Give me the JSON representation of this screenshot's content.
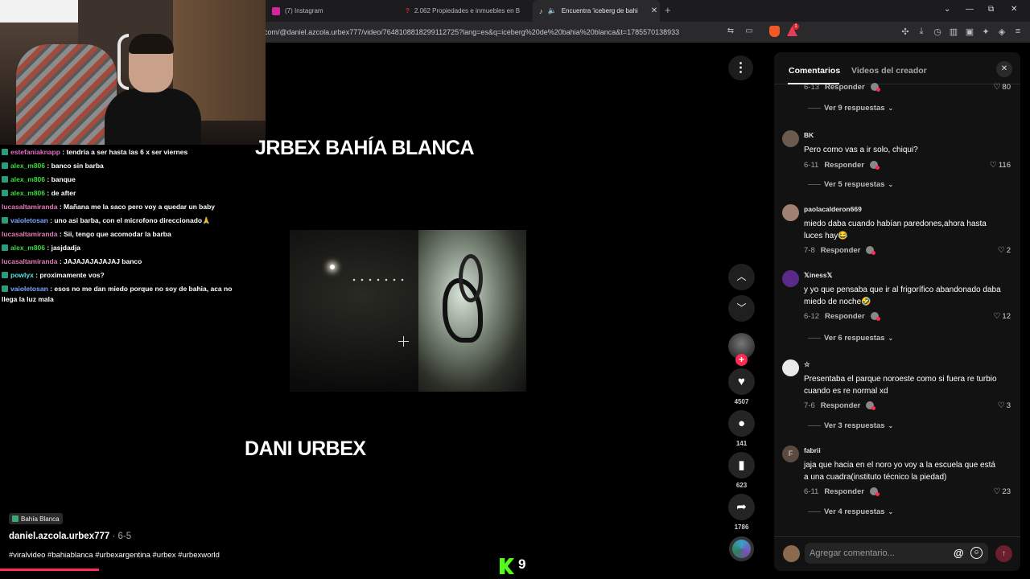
{
  "browser": {
    "tabs": [
      {
        "title": "(7) Instagram",
        "color": "#d6249f"
      },
      {
        "title": "2.062 Propiedades e inmuebles en B",
        "color": "#e0232a"
      },
      {
        "title": "Encuentra 'iceberg de bahia b",
        "color": "#ffffff"
      }
    ],
    "url": "com/@daniel.azcola.urbex777/video/7648108818299112725?lang=es&q=iceberg%20de%20bahia%20blanca&t=1785570138933",
    "notification_count": "1",
    "window_controls": {
      "collapse": "⌄",
      "minimize": "—",
      "restore": "⧉",
      "close": "✕"
    }
  },
  "chat": [
    {
      "user": "estefaniaknapp",
      "color": "#e26cc3",
      "message": ": tendria a ser hasta las 6 x ser viernes"
    },
    {
      "user": "alex_m806",
      "color": "#3cdc3c",
      "message": ": banco sin barba"
    },
    {
      "user": "alex_m806",
      "color": "#3cdc3c",
      "message": ": banque"
    },
    {
      "user": "alex_m806",
      "color": "#3cdc3c",
      "message": ": de after"
    },
    {
      "user": "lucasaltamiranda",
      "color": "#e27ab7",
      "message": ": Mañana me la saco pero voy a quedar un baby"
    },
    {
      "user": "vaioletosan",
      "color": "#7aa7ff",
      "message": ": uno asi barba, con el microfono direccionado🙏"
    },
    {
      "user": "lucasaltamiranda",
      "color": "#e27ab7",
      "message": ": Sii, tengo que acomodar la barba"
    },
    {
      "user": "alex_m806",
      "color": "#3cdc3c",
      "message": ": jasjdadja"
    },
    {
      "user": "lucasaltamiranda",
      "color": "#e27ab7",
      "message": ": JAJAJAJAJAJAJ banco"
    },
    {
      "user": "powlyx",
      "color": "#5fe0e0",
      "message": ": proximamente vos?"
    },
    {
      "user": "vaioletosan",
      "color": "#7aa7ff",
      "message": ": esos no me dan miedo porque no soy de bahia, aca no llega la luz mala"
    }
  ],
  "video": {
    "title_top": "JRBEX BAHÍA BLANCA",
    "title_bottom": "DANI URBEX",
    "location": "Bahía Blanca",
    "author": "daniel.azcola.urbex777",
    "date": " · 6-5",
    "hashtags": "#viralvideo #bahiablanca #urbexargentina #urbex #urbexworld",
    "more_icon": "⋮",
    "progress": 0.096,
    "kick_count": "9"
  },
  "actions": {
    "likes": "4507",
    "comments": "141",
    "saves": "623",
    "shares": "1786"
  },
  "panel": {
    "tab_comments": "Comentarios",
    "tab_creator_videos": "Videos del creador",
    "close": "✕",
    "reply_label": "Responder",
    "comments": [
      {
        "type": "partial",
        "meta": "6-13",
        "likes": "80",
        "replies": "Ver 9 respuestas"
      },
      {
        "avatar": "",
        "user": "BK",
        "text": "Pero como vas a ir solo, chiqui?",
        "meta": "6-11",
        "likes": "116",
        "replies": "Ver 5 respuestas"
      },
      {
        "avatar": "",
        "user": "paolacalderon669",
        "text": "miedo daba cuando habían paredones,ahora hasta luces hay😂",
        "meta": "7-8",
        "likes": "2",
        "replies": ""
      },
      {
        "avatar": "",
        "user": "𝕏iness𝕏",
        "text": "y yo que pensaba que ir al frigorífico abandonado daba miedo de noche🤣",
        "meta": "6-12",
        "likes": "12",
        "replies": "Ver 6 respuestas"
      },
      {
        "avatar": "",
        "user": "☆",
        "text": "Presentaba el parque noroeste como si fuera re turbio cuando es re normal xd",
        "meta": "7-6",
        "likes": "3",
        "replies": "Ver 3 respuestas"
      },
      {
        "avatar": "F",
        "user": "fabrii",
        "text": "jaja que hacia en el noro yo voy a la escuela que está a una cuadra(instituto técnico la piedad)",
        "meta": "6-11",
        "likes": "23",
        "replies": "Ver 4 respuestas"
      }
    ],
    "input_placeholder": "Agregar comentario...",
    "at_icon": "@",
    "send_icon": "↑"
  },
  "colors": {
    "accent": "#fe2c55",
    "kick": "#53fc18",
    "panel_bg": "#121212"
  }
}
